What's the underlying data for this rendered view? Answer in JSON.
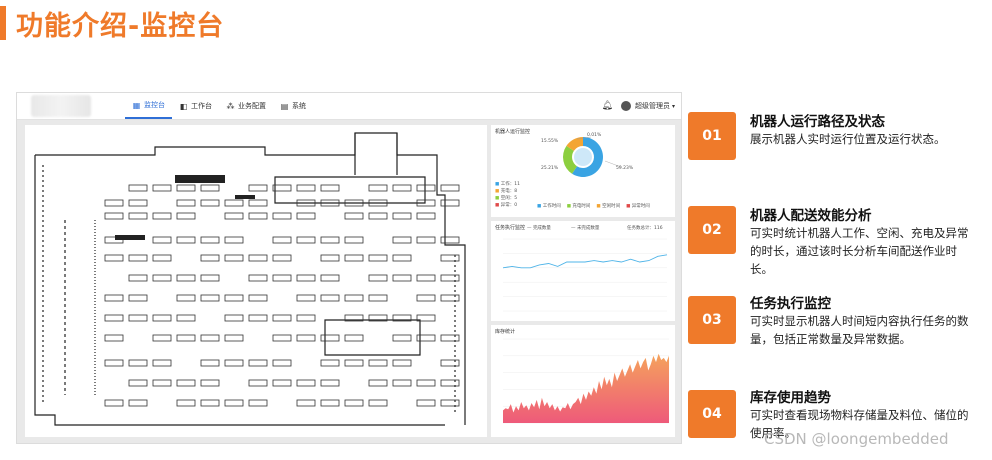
{
  "page_title": "功能介绍-监控台",
  "app": {
    "nav": [
      "监控台",
      "工作台",
      "业务配置",
      "系统"
    ],
    "user": "超级管理员"
  },
  "cards": {
    "robot_status": {
      "title": "机器人运行监控",
      "pct_labels": [
        "0.01%",
        "15.55%",
        "25.21%",
        "59.23%"
      ],
      "legend_counts": [
        "工作：11",
        "充电：8",
        "空闲：5",
        "异常：0"
      ],
      "legend_tabs": [
        "工作时间",
        "充电时间",
        "空闲时间",
        "异常时间"
      ]
    },
    "task_monitor": {
      "title": "任务执行监控",
      "legend": [
        "完成数量",
        "未完成数量"
      ],
      "total": "任务数总计：116"
    },
    "inventory": {
      "title": "库存统计"
    }
  },
  "features": [
    {
      "num": "01",
      "title": "机器人运行路径及状态",
      "desc": "展示机器人实时运行位置及运行状态。"
    },
    {
      "num": "02",
      "title": "机器人配送效能分析",
      "desc": "可实时统计机器人工作、空闲、充电及异常的时长，通过该时长分析车间配送作业时长。"
    },
    {
      "num": "03",
      "title": "任务执行监控",
      "desc": "可实时显示机器人时间短内容执行任务的数量，包括正常数量及异常数据。"
    },
    {
      "num": "04",
      "title": "库存使用趋势",
      "desc": "可实时查看现场物料存储量及料位、储位的使用率。"
    }
  ],
  "watermark": "CSDN @loongembedded",
  "chart_data": [
    {
      "type": "pie",
      "title": "机器人运行监控",
      "categories": [
        "工作",
        "充电",
        "空闲",
        "异常"
      ],
      "values": [
        59.23,
        25.21,
        15.55,
        0.01
      ],
      "colors": [
        "#3aa4e3",
        "#8ccf3f",
        "#f3a534",
        "#e04a4a"
      ]
    },
    {
      "type": "line",
      "title": "任务执行监控",
      "series": [
        {
          "name": "完成数量",
          "values": [
            30,
            31,
            30,
            30,
            32,
            33,
            31,
            34,
            34,
            34,
            35,
            34,
            35,
            34,
            36,
            34,
            35,
            38,
            39
          ]
        }
      ],
      "ylim": [
        0,
        50
      ],
      "color": "#4fb4e8"
    },
    {
      "type": "area",
      "title": "库存统计",
      "series": [
        {
          "name": "",
          "values": [
            12,
            14,
            13,
            18,
            10,
            16,
            12,
            20,
            14,
            17,
            12,
            19,
            15,
            22,
            13,
            24,
            16,
            20,
            14,
            18,
            12,
            16,
            11,
            15,
            14,
            19,
            13,
            18,
            20,
            24,
            18,
            28,
            22,
            30,
            26,
            34,
            28,
            40,
            32,
            44,
            36,
            42,
            34,
            48,
            40,
            46,
            52,
            44,
            50,
            56,
            48,
            54,
            60,
            52,
            58,
            62,
            50,
            56,
            64,
            58,
            66,
            60,
            62,
            58,
            64
          ]
        }
      ],
      "ylim": [
        0,
        80
      ],
      "color_top": "#f5a35c",
      "color_bottom": "#ee5a7a"
    }
  ]
}
